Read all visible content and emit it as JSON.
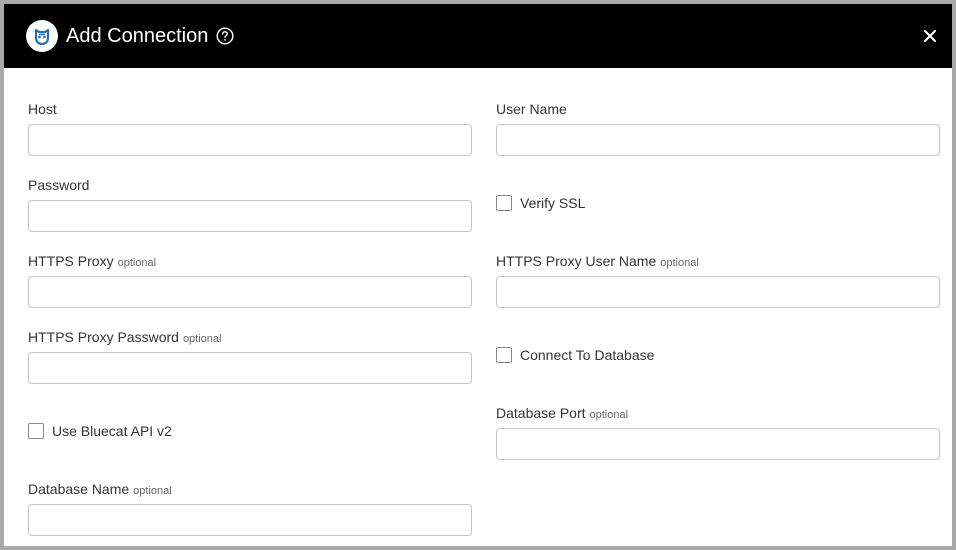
{
  "dialog": {
    "title": "Add Connection",
    "help_icon": "help-circle-icon",
    "close_icon": "close-icon",
    "logo_icon": "bluecat-logo-icon"
  },
  "fields": {
    "host": {
      "label": "Host",
      "value": "",
      "placeholder": ""
    },
    "user_name": {
      "label": "User Name",
      "value": "",
      "placeholder": ""
    },
    "password": {
      "label": "Password",
      "value": "",
      "placeholder": ""
    },
    "verify_ssl": {
      "label": "Verify SSL",
      "checked": false
    },
    "https_proxy": {
      "label": "HTTPS Proxy",
      "optional": "optional",
      "value": "",
      "placeholder": ""
    },
    "https_proxy_user_name": {
      "label": "HTTPS Proxy User Name",
      "optional": "optional",
      "value": "",
      "placeholder": ""
    },
    "https_proxy_password": {
      "label": "HTTPS Proxy Password",
      "optional": "optional",
      "value": "",
      "placeholder": ""
    },
    "connect_to_database": {
      "label": "Connect To Database",
      "checked": false
    },
    "use_bluecat_api_v2": {
      "label": "Use Bluecat API v2",
      "checked": false
    },
    "database_port": {
      "label": "Database Port",
      "optional": "optional",
      "value": "",
      "placeholder": ""
    },
    "database_name": {
      "label": "Database Name",
      "optional": "optional",
      "value": "",
      "placeholder": ""
    }
  },
  "colors": {
    "header_background": "#000000",
    "border": "#a9a9a9"
  }
}
